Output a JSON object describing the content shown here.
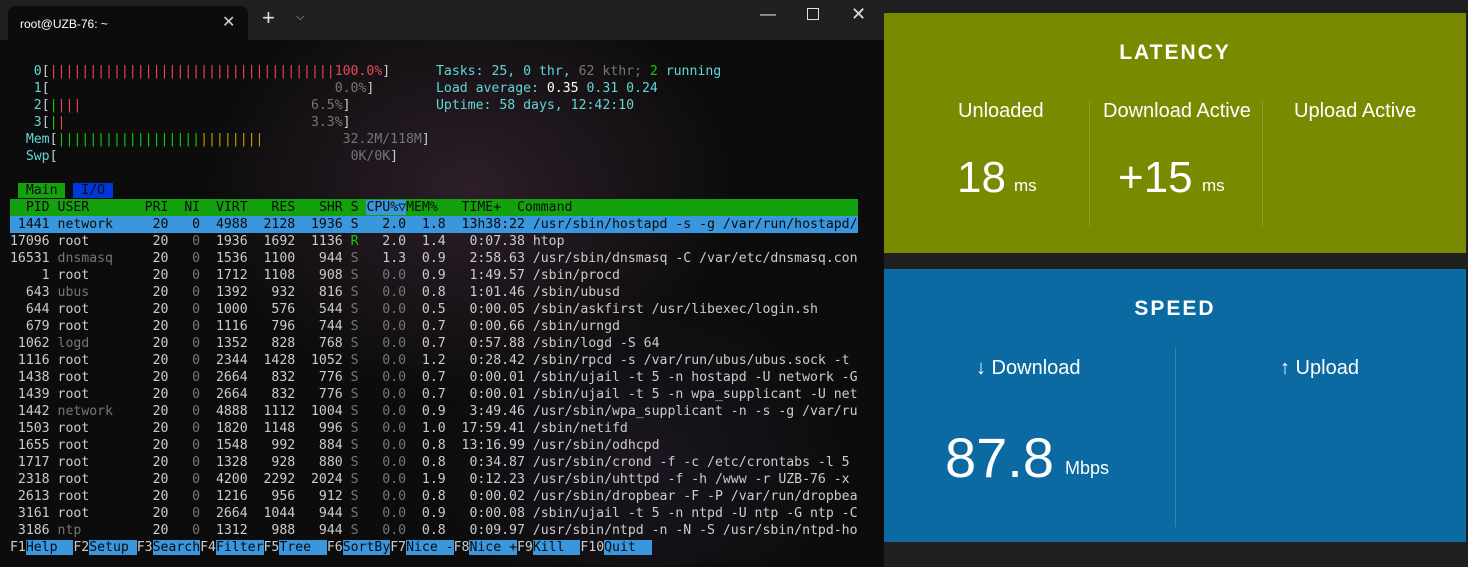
{
  "terminal": {
    "tab_title": "root@UZB-76: ~",
    "new_tab_glyph": "+",
    "close_glyph": "✕",
    "dropdown_glyph": "⌄",
    "htop": {
      "cpu": [
        {
          "id": "0",
          "bar": "||||||||||||||||||||||||||||||||||||",
          "value": "100.0%"
        },
        {
          "id": "1",
          "bar": "",
          "value": "0.0%"
        },
        {
          "id": "2",
          "bar": "||||",
          "value": "6.5%"
        },
        {
          "id": "3",
          "bar": "||",
          "value": "3.3%"
        }
      ],
      "mem": {
        "label": "Mem",
        "bar_green": "||||||||||||||||||",
        "bar_yellow": "||||||||",
        "value": "32.2M/118M"
      },
      "swp": {
        "label": "Swp",
        "value": "0K/0K"
      },
      "tasks": {
        "label": "Tasks:",
        "tasks": "25,",
        "thr": "0",
        "thr_label": "thr,",
        "kthr": "62 kthr;",
        "running": "2",
        "running_label": "running"
      },
      "load": {
        "label": "Load average:",
        "v1": "0.35",
        "v5": "0.31",
        "v15": "0.24"
      },
      "uptime": {
        "label": "Uptime:",
        "value": "58 days, 12:42:10"
      },
      "tabs": {
        "main": "Main",
        "io": "I/O"
      },
      "columns": {
        "pid": "PID",
        "user": "USER",
        "pri": "PRI",
        "ni": "NI",
        "virt": "VIRT",
        "res": "RES",
        "shr": "SHR",
        "s": "S",
        "cpu": "CPU%",
        "sort_arrow": "▽",
        "mem": "MEM%",
        "time": "TIME+",
        "command": "Command"
      },
      "processes": [
        {
          "pid": "1441",
          "user": "network",
          "pri": "20",
          "ni": "0",
          "virt": "4988",
          "res": "2128",
          "shr": "1936",
          "s": "S",
          "cpu": "2.0",
          "mem": "1.8",
          "time": "13h38:22",
          "command": "/usr/sbin/hostapd -s -g /var/run/hostapd/"
        },
        {
          "pid": "17096",
          "user": "root",
          "pri": "20",
          "ni": "0",
          "virt": "1936",
          "res": "1692",
          "shr": "1136",
          "s": "R",
          "cpu": "2.0",
          "mem": "1.4",
          "time": "0:07.38",
          "command": "htop"
        },
        {
          "pid": "16531",
          "user": "dnsmasq",
          "pri": "20",
          "ni": "0",
          "virt": "1536",
          "res": "1100",
          "shr": "944",
          "s": "S",
          "cpu": "1.3",
          "mem": "0.9",
          "time": "2:58.63",
          "command": "/usr/sbin/dnsmasq -C /var/etc/dnsmasq.con"
        },
        {
          "pid": "1",
          "user": "root",
          "pri": "20",
          "ni": "0",
          "virt": "1712",
          "res": "1108",
          "shr": "908",
          "s": "S",
          "cpu": "0.0",
          "mem": "0.9",
          "time": "1:49.57",
          "command": "/sbin/procd"
        },
        {
          "pid": "643",
          "user": "ubus",
          "pri": "20",
          "ni": "0",
          "virt": "1392",
          "res": "932",
          "shr": "816",
          "s": "S",
          "cpu": "0.0",
          "mem": "0.8",
          "time": "1:01.46",
          "command": "/sbin/ubusd"
        },
        {
          "pid": "644",
          "user": "root",
          "pri": "20",
          "ni": "0",
          "virt": "1000",
          "res": "576",
          "shr": "544",
          "s": "S",
          "cpu": "0.0",
          "mem": "0.5",
          "time": "0:00.05",
          "command": "/sbin/askfirst /usr/libexec/login.sh"
        },
        {
          "pid": "679",
          "user": "root",
          "pri": "20",
          "ni": "0",
          "virt": "1116",
          "res": "796",
          "shr": "744",
          "s": "S",
          "cpu": "0.0",
          "mem": "0.7",
          "time": "0:00.66",
          "command": "/sbin/urngd"
        },
        {
          "pid": "1062",
          "user": "logd",
          "pri": "20",
          "ni": "0",
          "virt": "1352",
          "res": "828",
          "shr": "768",
          "s": "S",
          "cpu": "0.0",
          "mem": "0.7",
          "time": "0:57.88",
          "command": "/sbin/logd -S 64"
        },
        {
          "pid": "1116",
          "user": "root",
          "pri": "20",
          "ni": "0",
          "virt": "2344",
          "res": "1428",
          "shr": "1052",
          "s": "S",
          "cpu": "0.0",
          "mem": "1.2",
          "time": "0:28.42",
          "command": "/sbin/rpcd -s /var/run/ubus/ubus.sock -t"
        },
        {
          "pid": "1438",
          "user": "root",
          "pri": "20",
          "ni": "0",
          "virt": "2664",
          "res": "832",
          "shr": "776",
          "s": "S",
          "cpu": "0.0",
          "mem": "0.7",
          "time": "0:00.01",
          "command": "/sbin/ujail -t 5 -n hostapd -U network -G"
        },
        {
          "pid": "1439",
          "user": "root",
          "pri": "20",
          "ni": "0",
          "virt": "2664",
          "res": "832",
          "shr": "776",
          "s": "S",
          "cpu": "0.0",
          "mem": "0.7",
          "time": "0:00.01",
          "command": "/sbin/ujail -t 5 -n wpa_supplicant -U net"
        },
        {
          "pid": "1442",
          "user": "network",
          "pri": "20",
          "ni": "0",
          "virt": "4888",
          "res": "1112",
          "shr": "1004",
          "s": "S",
          "cpu": "0.0",
          "mem": "0.9",
          "time": "3:49.46",
          "command": "/usr/sbin/wpa_supplicant -n -s -g /var/ru"
        },
        {
          "pid": "1503",
          "user": "root",
          "pri": "20",
          "ni": "0",
          "virt": "1820",
          "res": "1148",
          "shr": "996",
          "s": "S",
          "cpu": "0.0",
          "mem": "1.0",
          "time": "17:59.41",
          "command": "/sbin/netifd"
        },
        {
          "pid": "1655",
          "user": "root",
          "pri": "20",
          "ni": "0",
          "virt": "1548",
          "res": "992",
          "shr": "884",
          "s": "S",
          "cpu": "0.0",
          "mem": "0.8",
          "time": "13:16.99",
          "command": "/usr/sbin/odhcpd"
        },
        {
          "pid": "1717",
          "user": "root",
          "pri": "20",
          "ni": "0",
          "virt": "1328",
          "res": "928",
          "shr": "880",
          "s": "S",
          "cpu": "0.0",
          "mem": "0.8",
          "time": "0:34.87",
          "command": "/usr/sbin/crond -f -c /etc/crontabs -l 5"
        },
        {
          "pid": "2318",
          "user": "root",
          "pri": "20",
          "ni": "0",
          "virt": "4200",
          "res": "2292",
          "shr": "2024",
          "s": "S",
          "cpu": "0.0",
          "mem": "1.9",
          "time": "0:12.23",
          "command": "/usr/sbin/uhttpd -f -h /www -r UZB-76 -x"
        },
        {
          "pid": "2613",
          "user": "root",
          "pri": "20",
          "ni": "0",
          "virt": "1216",
          "res": "956",
          "shr": "912",
          "s": "S",
          "cpu": "0.0",
          "mem": "0.8",
          "time": "0:00.02",
          "command": "/usr/sbin/dropbear -F -P /var/run/dropbea"
        },
        {
          "pid": "3161",
          "user": "root",
          "pri": "20",
          "ni": "0",
          "virt": "2664",
          "res": "1044",
          "shr": "944",
          "s": "S",
          "cpu": "0.0",
          "mem": "0.9",
          "time": "0:00.08",
          "command": "/sbin/ujail -t 5 -n ntpd -U ntp -G ntp -C"
        },
        {
          "pid": "3186",
          "user": "ntp",
          "pri": "20",
          "ni": "0",
          "virt": "1312",
          "res": "988",
          "shr": "944",
          "s": "S",
          "cpu": "0.0",
          "mem": "0.8",
          "time": "0:09.97",
          "command": "/usr/sbin/ntpd -n -N -S /usr/sbin/ntpd-ho"
        }
      ],
      "fkeys": [
        {
          "key": "F1",
          "label": "Help  "
        },
        {
          "key": "F2",
          "label": "Setup "
        },
        {
          "key": "F3",
          "label": "Search"
        },
        {
          "key": "F4",
          "label": "Filter"
        },
        {
          "key": "F5",
          "label": "Tree  "
        },
        {
          "key": "F6",
          "label": "SortBy"
        },
        {
          "key": "F7",
          "label": "Nice -"
        },
        {
          "key": "F8",
          "label": "Nice +"
        },
        {
          "key": "F9",
          "label": "Kill  "
        },
        {
          "key": "F10",
          "label": "Quit  "
        }
      ]
    }
  },
  "speedtest": {
    "latency": {
      "title": "LATENCY",
      "unloaded_label": "Unloaded",
      "unloaded_value": "18",
      "unloaded_unit": "ms",
      "download_active_label": "Download Active",
      "download_active_value": "+15",
      "download_active_unit": "ms",
      "upload_active_label": "Upload Active"
    },
    "speed": {
      "title": "SPEED",
      "download_label": "↓ Download",
      "download_value": "87.8",
      "download_unit": "Mbps",
      "upload_label": "↑ Upload"
    },
    "colors": {
      "latency_bg": "#7a8a00",
      "speed_bg": "#0a6aa1"
    }
  }
}
